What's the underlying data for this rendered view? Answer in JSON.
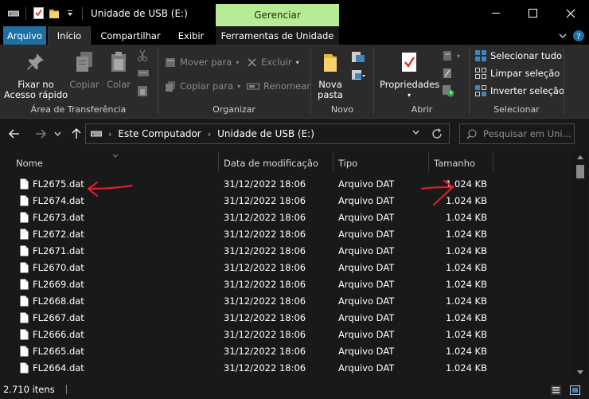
{
  "window": {
    "title": "Unidade de USB (E:)",
    "context_tab_group": "Gerenciar"
  },
  "ribbon_tabs": {
    "file": "Arquivo",
    "home": "Início",
    "share": "Compartilhar",
    "view": "Exibir",
    "drive_tools": "Ferramentas de Unidade"
  },
  "ribbon": {
    "clipboard": {
      "pin_quick_access_1": "Fixar no",
      "pin_quick_access_2": "Acesso rápido",
      "copy": "Copiar",
      "paste": "Colar",
      "group_label": "Área de Transferência"
    },
    "organize": {
      "move_to": "Mover para",
      "copy_to": "Copiar para",
      "delete": "Excluir",
      "rename": "Renomear",
      "group_label": "Organizar"
    },
    "new": {
      "new_folder_1": "Nova",
      "new_folder_2": "pasta",
      "group_label": "Novo"
    },
    "open": {
      "properties": "Propriedades",
      "group_label": "Abrir"
    },
    "select": {
      "select_all": "Selecionar tudo",
      "select_none": "Limpar seleção",
      "invert_selection": "Inverter seleção",
      "group_label": "Selecionar"
    }
  },
  "address": {
    "crumbs": [
      "Este Computador",
      "Unidade de USB (E:)"
    ],
    "search_placeholder": "Pesquisar em Uni..."
  },
  "columns": {
    "name": "Nome",
    "date": "Data de modificação",
    "type": "Tipo",
    "size": "Tamanho"
  },
  "files": [
    {
      "name": "FL2675.dat",
      "date": "31/12/2022 18:06",
      "type": "Arquivo DAT",
      "size": "1.024 KB"
    },
    {
      "name": "FL2674.dat",
      "date": "31/12/2022 18:06",
      "type": "Arquivo DAT",
      "size": "1.024 KB"
    },
    {
      "name": "FL2673.dat",
      "date": "31/12/2022 18:06",
      "type": "Arquivo DAT",
      "size": "1.024 KB"
    },
    {
      "name": "FL2672.dat",
      "date": "31/12/2022 18:06",
      "type": "Arquivo DAT",
      "size": "1.024 KB"
    },
    {
      "name": "FL2671.dat",
      "date": "31/12/2022 18:06",
      "type": "Arquivo DAT",
      "size": "1.024 KB"
    },
    {
      "name": "FL2670.dat",
      "date": "31/12/2022 18:06",
      "type": "Arquivo DAT",
      "size": "1.024 KB"
    },
    {
      "name": "FL2669.dat",
      "date": "31/12/2022 18:06",
      "type": "Arquivo DAT",
      "size": "1.024 KB"
    },
    {
      "name": "FL2668.dat",
      "date": "31/12/2022 18:06",
      "type": "Arquivo DAT",
      "size": "1.024 KB"
    },
    {
      "name": "FL2667.dat",
      "date": "31/12/2022 18:06",
      "type": "Arquivo DAT",
      "size": "1.024 KB"
    },
    {
      "name": "FL2666.dat",
      "date": "31/12/2022 18:06",
      "type": "Arquivo DAT",
      "size": "1.024 KB"
    },
    {
      "name": "FL2665.dat",
      "date": "31/12/2022 18:06",
      "type": "Arquivo DAT",
      "size": "1.024 KB"
    },
    {
      "name": "FL2664.dat",
      "date": "31/12/2022 18:06",
      "type": "Arquivo DAT",
      "size": "1.024 KB"
    }
  ],
  "status": {
    "item_count": "2.710 itens"
  },
  "colors": {
    "file_tab": "#1d6fa5",
    "context_tab": "#b7eb96",
    "annotation": "#e8202a"
  }
}
